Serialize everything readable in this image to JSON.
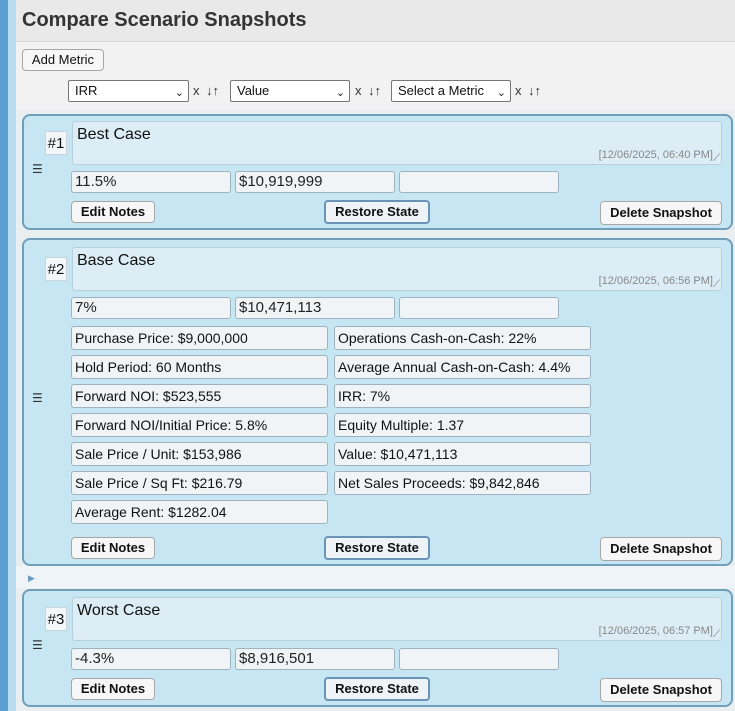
{
  "header": {
    "title": "Compare Scenario Snapshots"
  },
  "toolbar": {
    "add_metric": "Add Metric",
    "remove_glyph": "x",
    "sort_glyph": "↓↑",
    "dropdown_glyph": "⌄",
    "selects": [
      "IRR",
      "Value",
      "Select a Metric"
    ]
  },
  "snapshots": [
    {
      "rank": "#1",
      "handle": "☰",
      "notes": "Best Case",
      "timestamp": "[12/06/2025, 06:40 PM]",
      "metrics": [
        "11.5%",
        "$10,919,999",
        ""
      ],
      "details": []
    },
    {
      "rank": "#2",
      "handle": "☰",
      "notes": "Base Case",
      "timestamp": "[12/06/2025, 06:56 PM]",
      "metrics": [
        "7%",
        "$10,471,113",
        ""
      ],
      "details_left": [
        "Purchase Price: $9,000,000",
        "Hold Period: 60 Months",
        "Forward NOI: $523,555",
        "Forward NOI/Initial Price: 5.8%",
        "Sale Price / Unit: $153,986",
        "Sale Price / Sq Ft: $216.79",
        "Average Rent: $1282.04"
      ],
      "details_right": [
        "Operations Cash-on-Cash: 22%",
        "Average Annual Cash-on-Cash: 4.4%",
        "IRR: 7%",
        "Equity Multiple: 1.37",
        "Value: $10,471,113",
        "Net Sales Proceeds: $9,842,846"
      ]
    },
    {
      "rank": "#3",
      "handle": "☰",
      "notes": "Worst Case",
      "timestamp": "[12/06/2025, 06:57 PM]",
      "metrics": [
        "-4.3%",
        "$8,916,501",
        ""
      ],
      "details": []
    }
  ],
  "actions": {
    "edit_notes": "Edit Notes",
    "restore_state": "Restore State",
    "delete_snapshot": "Delete Snapshot"
  },
  "divider_glyph": "▶",
  "resize_glyph": "⟋",
  "colors": {
    "panel_bg": "#c7e6f3",
    "panel_border": "#6f9fb9",
    "left_strip": "#5a9fd0"
  }
}
